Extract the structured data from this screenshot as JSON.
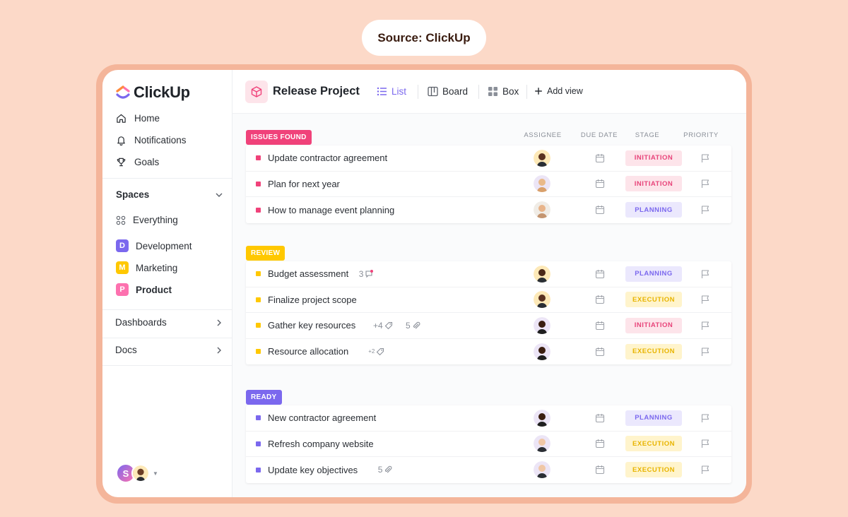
{
  "source_label": "Source: ClickUp",
  "brand": {
    "name": "ClickUp"
  },
  "sidebar": {
    "nav": [
      {
        "label": "Home",
        "icon": "home-icon"
      },
      {
        "label": "Notifications",
        "icon": "bell-icon"
      },
      {
        "label": "Goals",
        "icon": "trophy-icon"
      }
    ],
    "spaces_label": "Spaces",
    "everything_label": "Everything",
    "spaces": [
      {
        "letter": "D",
        "label": "Development",
        "color": "#7b68ee"
      },
      {
        "letter": "M",
        "label": "Marketing",
        "color": "#ffc800"
      },
      {
        "letter": "P",
        "label": "Product",
        "color": "#fd71af"
      }
    ],
    "dashboards_label": "Dashboards",
    "docs_label": "Docs",
    "user_initial": "S"
  },
  "topbar": {
    "project_title": "Release Project",
    "views": [
      {
        "label": "List",
        "icon": "list-icon"
      },
      {
        "label": "Board",
        "icon": "board-icon"
      },
      {
        "label": "Box",
        "icon": "box-icon"
      }
    ],
    "add_view_label": "Add view"
  },
  "columns": {
    "assignee": "ASSIGNEE",
    "due_date": "DUE DATE",
    "stage": "STAGE",
    "priority": "PRIORITY"
  },
  "groups": [
    {
      "label": "ISSUES FOUND",
      "color": "#f0427a",
      "tasks": [
        {
          "name": "Update contractor agreement",
          "stage": "INITIATION"
        },
        {
          "name": "Plan for next year",
          "stage": "INITIATION"
        },
        {
          "name": "How to manage event planning",
          "stage": "PLANNING"
        }
      ]
    },
    {
      "label": "REVIEW",
      "color": "#ffc800",
      "tasks": [
        {
          "name": "Budget assessment",
          "comments": "3",
          "stage": "PLANNING"
        },
        {
          "name": "Finalize project scope",
          "stage": "EXECUTION"
        },
        {
          "name": "Gather key resources",
          "tags": "+4",
          "attachments": "5",
          "stage": "INITIATION"
        },
        {
          "name": "Resource allocation",
          "tags": "+2",
          "stage": "EXECUTION"
        }
      ]
    },
    {
      "label": "READY",
      "color": "#7b68ee",
      "tasks": [
        {
          "name": "New contractor agreement",
          "stage": "PLANNING"
        },
        {
          "name": "Refresh company website",
          "stage": "EXECUTION"
        },
        {
          "name": "Update key objectives",
          "attachments": "5",
          "stage": "EXECUTION"
        }
      ]
    }
  ]
}
